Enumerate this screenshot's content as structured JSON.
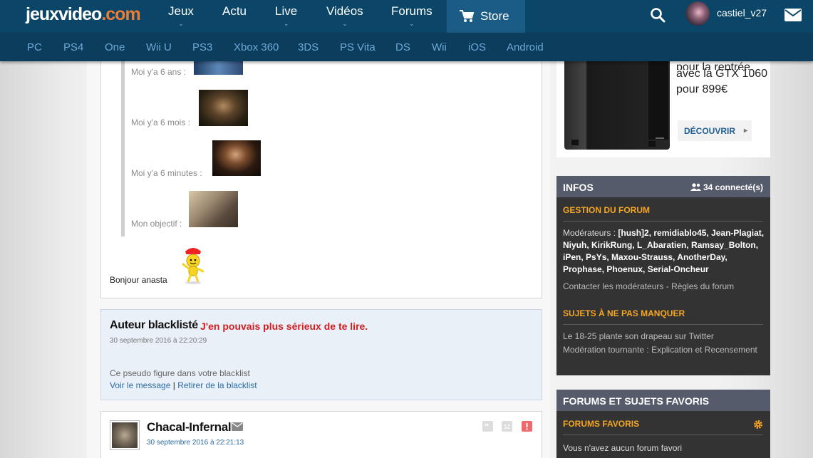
{
  "header": {
    "logo_main": "jeuxvideo",
    "logo_suffix": ".com",
    "nav": [
      {
        "label": "Jeux",
        "chevron": true
      },
      {
        "label": "Actu",
        "chevron": false
      },
      {
        "label": "Live",
        "chevron": true
      },
      {
        "label": "Vidéos",
        "chevron": true
      },
      {
        "label": "Forums",
        "chevron": true
      }
    ],
    "store_label": "Store",
    "username": "castiel_v27"
  },
  "platforms": [
    "PC",
    "PS4",
    "One",
    "Wii U",
    "PS3",
    "Xbox 360",
    "3DS",
    "PS Vita",
    "DS",
    "Wii",
    "iOS",
    "Android"
  ],
  "post1": {
    "quote_lines": [
      "Moi y'a 6 ans :",
      "Moi y'a 6 mois :",
      "Moi y'a 6 minutes :",
      "Mon objectif :"
    ],
    "text": "Bonjour anasta"
  },
  "blacklisted_post": {
    "author": "Auteur blacklisté",
    "remark": "J'en pouvais plus sérieux de te lire.",
    "date": "30 septembre 2016 à 22:20:29",
    "message": "Ce pseudo figure dans votre blacklist",
    "view_link": "Voir le message",
    "separator": "|",
    "remove_link": "Retirer de la blacklist"
  },
  "post3": {
    "author": "Chacal-Infernal",
    "date": "30 septembre 2016 à 22:21:13"
  },
  "promo": {
    "line1": "pour la rentrée",
    "line2": "avec la GTX 1060",
    "line3": "pour 899€",
    "button": "DÉCOUVRIR"
  },
  "infos": {
    "title": "INFOS",
    "connected": "34 connecté(s)",
    "gestion_title": "GESTION DU FORUM",
    "moderators_label": "Modérateurs :",
    "moderators": "[hush]2, remidiablo45, Jean-Plagiat, Niyuh, KirikRung, L_Abaratien, Ramsay_Bolton, iPen, PsYs, Maxou-Strauss, AnotherDay, Prophase, Phoenux, Serial-Oncheur",
    "contact_link": "Contacter les modérateurs",
    "dash": " - ",
    "rules_link": "Règles du forum",
    "topics_title": "SUJETS À NE PAS MANQUER",
    "topic1": "Le 18-25 plante son drapeau sur Twitter",
    "topic2": "Modération tournante : Explication et Recensement"
  },
  "favorites": {
    "title": "FORUMS ET SUJETS FAVORIS",
    "section": "FORUMS FAVORIS",
    "empty": "Vous n'avez aucun forum favori"
  },
  "colors": {
    "header_bg": "#0b4567",
    "platform_bg": "#0d3d5d",
    "logo_accent": "#f27b30",
    "panel_accent": "#f5a623",
    "blacklist_remark": "#d01f1f",
    "link": "#2a6aa5"
  }
}
